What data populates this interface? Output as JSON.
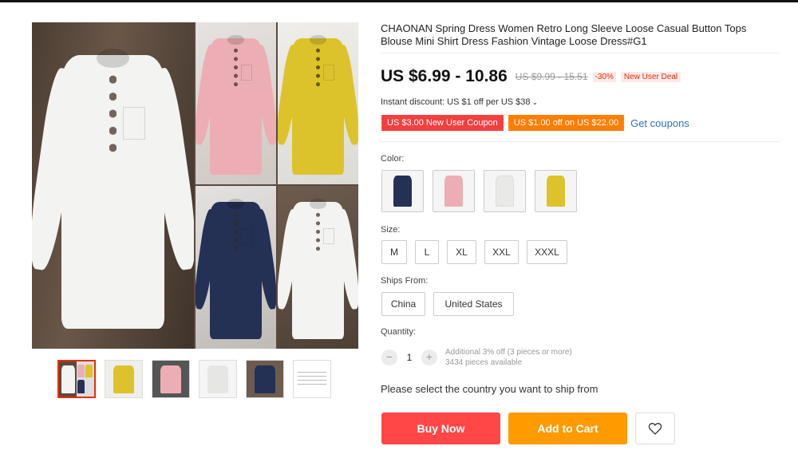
{
  "product": {
    "title": "CHAONAN Spring Dress Women Retro Long Sleeve Loose Casual Button Tops Blouse Mini Shirt Dress Fashion Vintage Loose Dress#G1",
    "price": "US $6.99 - 10.86",
    "old_price": "US $9.99 - 15.51",
    "discount": "-30%",
    "deal_badge": "New User Deal",
    "instant_discount": "Instant discount: US $1 off per US $38",
    "coupons": [
      "US $3.00 New User Coupon",
      "US $1.00 off on US $22.00"
    ],
    "get_coupons": "Get coupons"
  },
  "color": {
    "label": "Color:",
    "options": [
      {
        "name": "navy",
        "hex": "#253055"
      },
      {
        "name": "pink",
        "hex": "#ecaeb4"
      },
      {
        "name": "white",
        "hex": "#f3f3f1"
      },
      {
        "name": "yellow",
        "hex": "#dcc32c"
      }
    ]
  },
  "size": {
    "label": "Size:",
    "options": [
      "M",
      "L",
      "XL",
      "XXL",
      "XXXL"
    ]
  },
  "ships_from": {
    "label": "Ships From:",
    "options": [
      "China",
      "United States"
    ]
  },
  "quantity": {
    "label": "Quantity:",
    "minus": "−",
    "value": "1",
    "plus": "+",
    "note": "Additional 3% off (3 pieces or more)",
    "available": "3434 pieces available"
  },
  "ship_message": "Please select the country you want to ship from",
  "actions": {
    "buy_now": "Buy Now",
    "add_to_cart": "Add to Cart",
    "wishlist_icon": "heart-icon"
  },
  "colors": {
    "buy": "#ff4747",
    "cart": "#ff9a00",
    "coupon_red": "#f33f3f",
    "coupon_orange": "#ff7d00",
    "link": "#2e73b8",
    "active_thumb": "#e62e04"
  }
}
